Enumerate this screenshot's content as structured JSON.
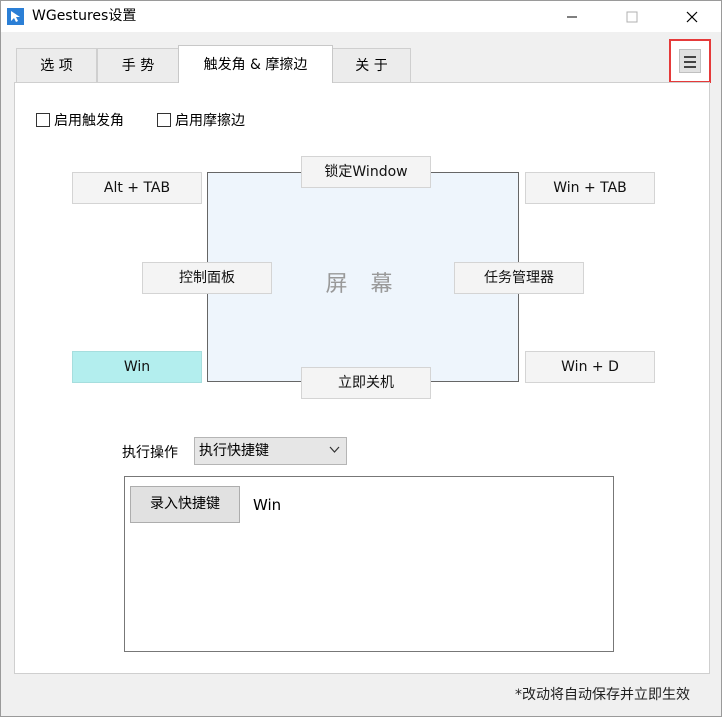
{
  "window": {
    "title": "WGestures设置"
  },
  "tabs": [
    {
      "label": "选 项"
    },
    {
      "label": "手 势"
    },
    {
      "label": "触发角 & 摩擦边"
    },
    {
      "label": "关 于"
    }
  ],
  "options": {
    "enable_corners": "启用触发角",
    "enable_edges": "启用摩擦边"
  },
  "screen": {
    "label": "屏 幕",
    "top_edge": "锁定Window",
    "top_left": "Alt + TAB",
    "top_right": "Win + TAB",
    "left_edge": "控制面板",
    "right_edge": "任务管理器",
    "bottom_left": "Win",
    "bottom_right": "Win + D",
    "bottom_edge": "立即关机"
  },
  "action": {
    "label": "执行操作",
    "selected": "执行快捷键",
    "record_button": "录入快捷键",
    "shortcut_value": "Win"
  },
  "footer": {
    "note": "*改动将自动保存并立即生效"
  },
  "colors": {
    "selected": "#b3eeee",
    "highlight_border": "#e53a3a",
    "screen_bg": "#eef5fc"
  }
}
